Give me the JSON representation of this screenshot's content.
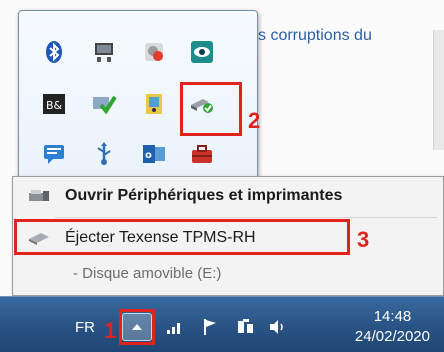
{
  "background": {
    "doc_text": "s corruptions du"
  },
  "tray_icons": [
    "bluetooth-icon",
    "network-drive-icon",
    "disk-utility-icon",
    "eye-viewer-icon",
    "bs-app-icon",
    "security-check-icon",
    "media-icon",
    "safely-remove-hardware-icon",
    "chat-icon",
    "usb-icon",
    "outlook-icon",
    "toolbox-icon"
  ],
  "context_menu": {
    "open_devices": "Ouvrir Périphériques et imprimantes",
    "eject": "Éjecter Texense TPMS-RH",
    "removable_disk": "- Disque amovible (E:)"
  },
  "annotations": {
    "step1": "1",
    "step2": "2",
    "step3": "3"
  },
  "taskbar": {
    "language": "FR",
    "time": "14:48",
    "date": "24/02/2020"
  },
  "colors": {
    "annotation_red": "#e0231c",
    "taskbar_blue": "#2c5688",
    "doc_link_blue": "#2b5fa8"
  }
}
